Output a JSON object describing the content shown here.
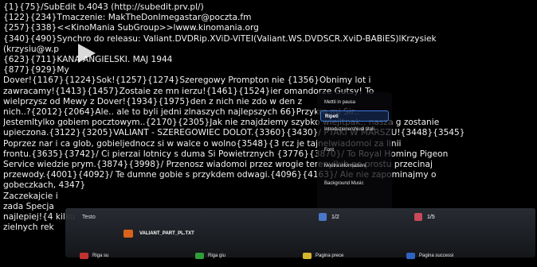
{
  "subtitle_lines": [
    "{1}{75}/SubEdit b.4043 (http://subedit.prv.pl/)",
    "{122}{234}Tmaczenie: MakTheDonImegastar@poczta.fm",
    "{257}{338}<<KinoMania SubGroup>>lwww.kinomania.org",
    "{340}{490}Synchro do releasu: Valiant.DVDRip.XViD-ViTEI(Valiant.WS.DVDSCR.XviD-BABiES)lKrzysiek",
    "(krzysiu@w.p",
    "{623}{711}KANA ANGIELSKI. MAJ 1944",
    "{877}{929}My",
    "Dover!{1167}{1224}Sok!{1257}{1274}Szeregowy Prompton nie                  {1356}Obnimy lot i",
    "zawracamy!{1413}{1457}Zostaie ze mn ierzu!{1461}{1524}ier                  omandorze Gutsy! To",
    "wielprzysz od Mewy z Dover!{1934}{1975}den z nich nie zdo w                  den z",
    "nich..?{2012}{2064}Ale.. ale to byli jedni zlnaszych najlepszych                  66}Przykro mi Sir..",
    "Jestemltylko gobiem pocztowym..{2170}{2305}Jak nie znajdziemy szybko wiejltpak.. nasza g zostanie",
    "upieczona.{3122}{3205}VALIANT - SZEREGOWIEC DOLOT.{3360}{3430}/ PTAKI W MARSZU!{3448}{3545}",
    "Poprzez nar i ca glob, gobieljednocz si w walce o wolno{3548}{3         rcz je tajnelwiadomoi za linii",
    "frontu.{3635}{3742}/ Ci pierzai lotnicy s duma Si Powietrznych {3776}{3870}/ To Royal Homing Pigeon",
    "Service wiedzie prym.{3874}{3998}/ Przenosz wiadomoi przez wrogie terenyllub po prostu przecinaj",
    "przewody.{4001}{4092}/ Te dumne gobie s przykdem odwagi.{4096}{4163}/ Ale nie zapominajmy o",
    "gobeczkach,                                                                    4347}",
    "Zaczekajcie                                                                         i",
    "zada Specja",
    "najlepiej!{4                                                              kilku",
    "zielnych rek"
  ],
  "context_menu": {
    "items": [
      "Mettti in pausa",
      "Ripeti",
      "Introduzione/chiudi titoli",
      "Font",
      "Mostra informazioni",
      "Background Music"
    ],
    "selected_index": 1
  },
  "bottom_panel": {
    "label": "Testo",
    "file_name": "VALIANT_PART_PL.TXT",
    "page_left": "1/2",
    "page_right": "1/5"
  },
  "footer_buttons": [
    "Riga su",
    "Riga giu",
    "Pagina prece",
    "Pagina successi"
  ],
  "colors": {
    "accent_blue": "#3d7bd8",
    "file_orange": "#d9631c",
    "btn_red": "#c23030",
    "btn_green": "#2f9e3a",
    "btn_yellow": "#d6b62a",
    "btn_blue": "#2f63c2"
  }
}
